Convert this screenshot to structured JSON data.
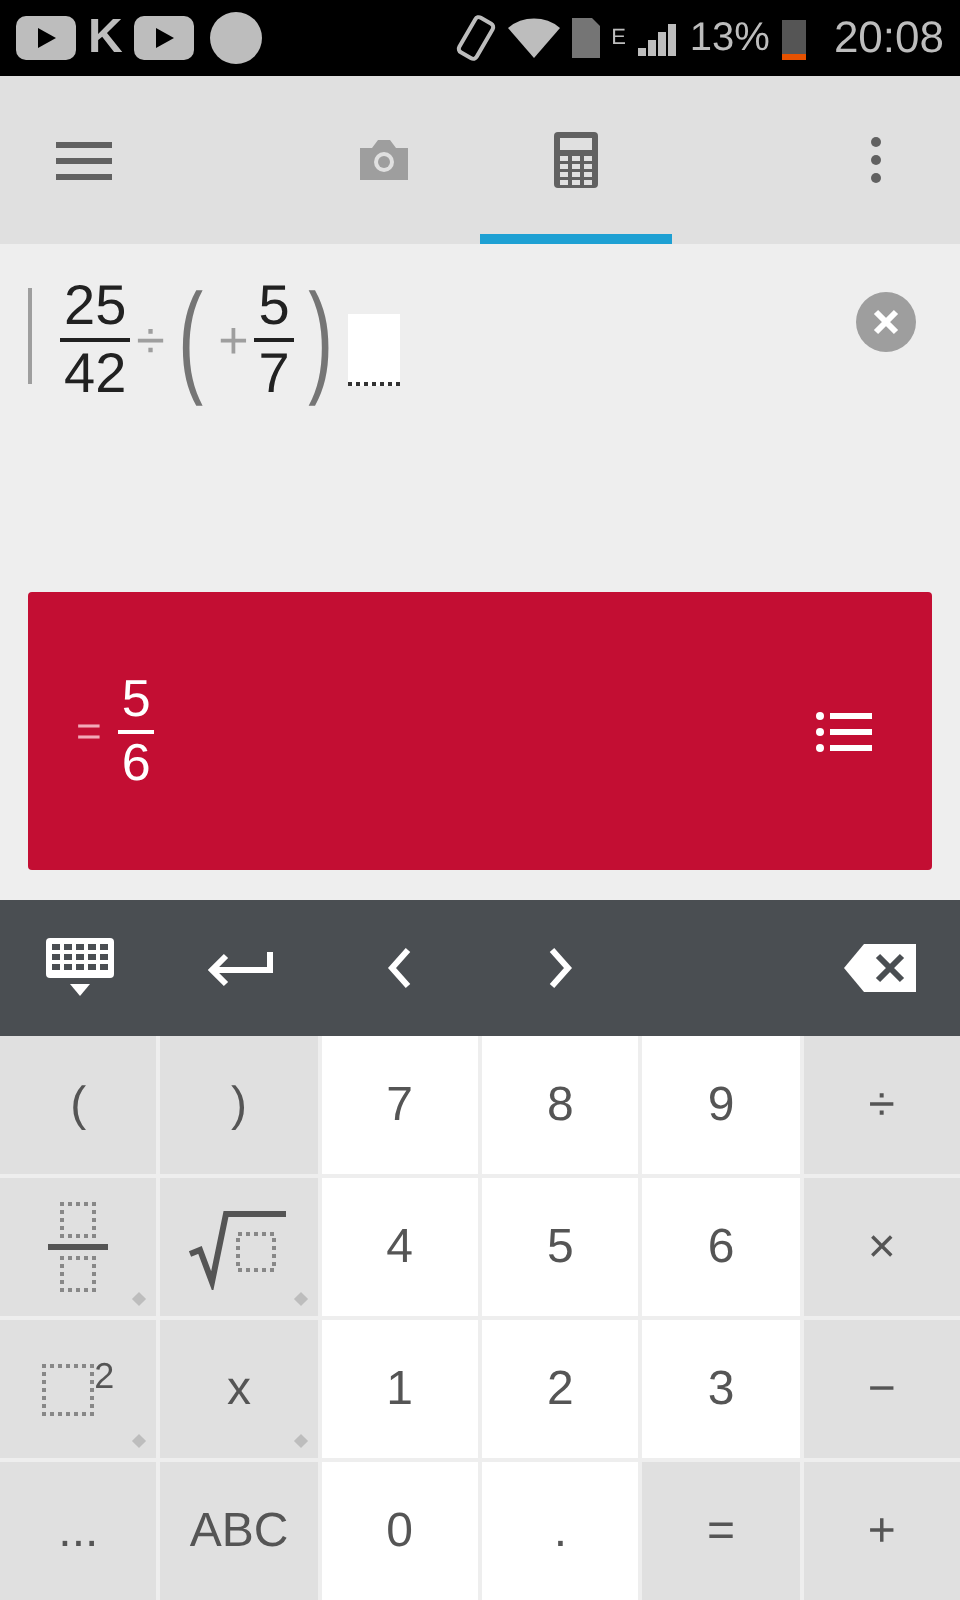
{
  "status_bar": {
    "app_letter": "K",
    "network": "E",
    "battery": "13%",
    "time": "20:08"
  },
  "tabs": [
    {
      "kind": "camera",
      "selected": false
    },
    {
      "kind": "calculator",
      "selected": true
    }
  ],
  "expression": [
    {
      "kind": "fraction",
      "num": "25",
      "den": "42"
    },
    {
      "kind": "op",
      "text": "÷"
    },
    {
      "kind": "paren",
      "text": "("
    },
    {
      "kind": "op",
      "text": "+"
    },
    {
      "kind": "fraction",
      "num": "5",
      "den": "7"
    },
    {
      "kind": "paren",
      "text": ")"
    },
    {
      "kind": "cursor"
    }
  ],
  "result": {
    "sign": "=",
    "num": "5",
    "den": "6"
  },
  "keypad": [
    [
      {
        "kind": "key",
        "label": "(",
        "more": false
      },
      {
        "kind": "key",
        "label": ")",
        "more": false
      },
      {
        "kind": "digit",
        "label": "7",
        "more": false
      },
      {
        "kind": "digit",
        "label": "8",
        "more": false
      },
      {
        "kind": "digit",
        "label": "9",
        "more": false
      },
      {
        "kind": "key",
        "label": "÷",
        "more": false
      }
    ],
    [
      {
        "kind": "fraction",
        "more": true
      },
      {
        "kind": "sqrt",
        "more": true
      },
      {
        "kind": "digit",
        "label": "4",
        "more": false
      },
      {
        "kind": "digit",
        "label": "5",
        "more": false
      },
      {
        "kind": "digit",
        "label": "6",
        "more": false
      },
      {
        "kind": "key",
        "label": "×",
        "more": false
      }
    ],
    [
      {
        "kind": "square",
        "label": "2",
        "more": true
      },
      {
        "kind": "key",
        "label": "x",
        "more": true
      },
      {
        "kind": "digit",
        "label": "1",
        "more": false
      },
      {
        "kind": "digit",
        "label": "2",
        "more": false
      },
      {
        "kind": "digit",
        "label": "3",
        "more": false
      },
      {
        "kind": "key",
        "label": "−",
        "more": false
      }
    ],
    [
      {
        "kind": "key",
        "label": "...",
        "more": false
      },
      {
        "kind": "key",
        "label": "ABC",
        "more": false
      },
      {
        "kind": "digit",
        "label": "0",
        "more": false
      },
      {
        "kind": "digit",
        "label": ".",
        "more": false
      },
      {
        "kind": "key",
        "label": "=",
        "more": false
      },
      {
        "kind": "key",
        "label": "+",
        "more": false
      }
    ]
  ]
}
